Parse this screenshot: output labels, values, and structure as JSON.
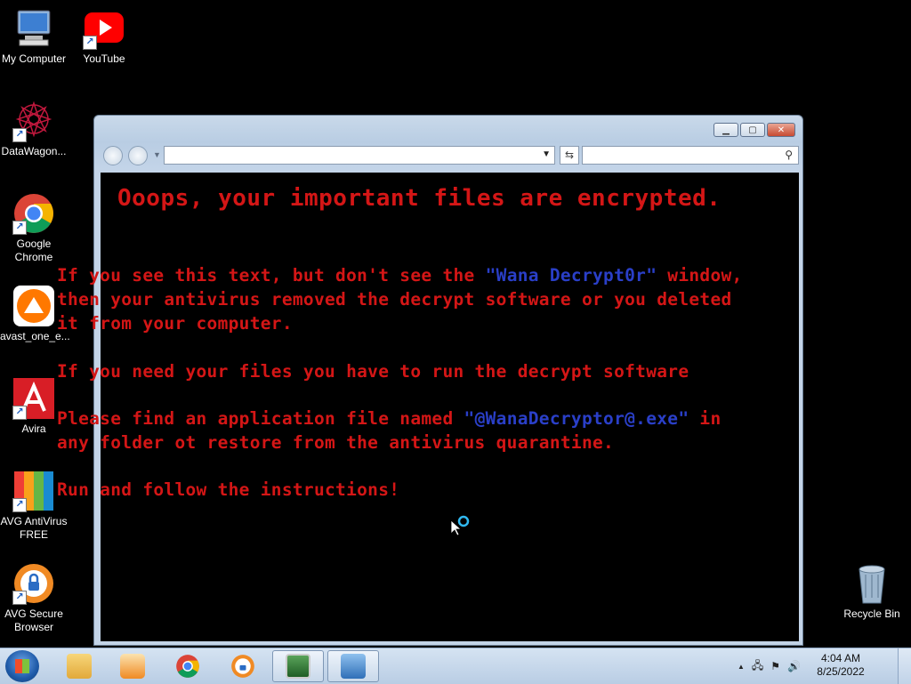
{
  "desktop": {
    "icons": [
      {
        "label": "My Computer",
        "icon": "computer-icon"
      },
      {
        "label": "YouTube",
        "icon": "youtube-icon"
      },
      {
        "label": "DataWagon...",
        "icon": "datawagon-icon"
      },
      {
        "label": "Google\nChrome",
        "icon": "chrome-icon"
      },
      {
        "label": "avast_one_e...",
        "icon": "avast-icon"
      },
      {
        "label": "Avira",
        "icon": "avira-icon"
      },
      {
        "label": "AVG AntiVirus\nFREE",
        "icon": "avg-antivirus-icon"
      },
      {
        "label": "AVG Secure\nBrowser",
        "icon": "avg-browser-icon"
      },
      {
        "label": "Recycle Bin",
        "icon": "recycle-bin-icon"
      }
    ]
  },
  "window": {
    "address_value": "",
    "search_value": "",
    "title_text": "Ooops, your important files are encrypted.",
    "paragraphs": {
      "p1_line1_a": "If you see this text, but don't see the ",
      "p1_line1_b": "\"Wana Decrypt0r\"",
      "p1_line1_c": " window,",
      "p1_line2": "then your antivirus removed the decrypt software or you deleted",
      "p1_line3": "it from your computer.",
      "p2_line1": "If you need your files you have to run the decrypt software",
      "p3_line1_a": "Please find an application file named ",
      "p3_line1_b": "\"@WanaDecryptor@.exe\"",
      "p3_line1_c": " in",
      "p3_line2": "any folder ot restore from the antivirus quarantine.",
      "p4_line1": "Run and follow the instructions!"
    },
    "colors": {
      "text": "#d41616",
      "highlight": "#2a3fc8",
      "background": "#000000"
    }
  },
  "taskbar": {
    "clock_time": "4:04 AM",
    "clock_date": "8/25/2022",
    "tray_arrow": "▲"
  }
}
